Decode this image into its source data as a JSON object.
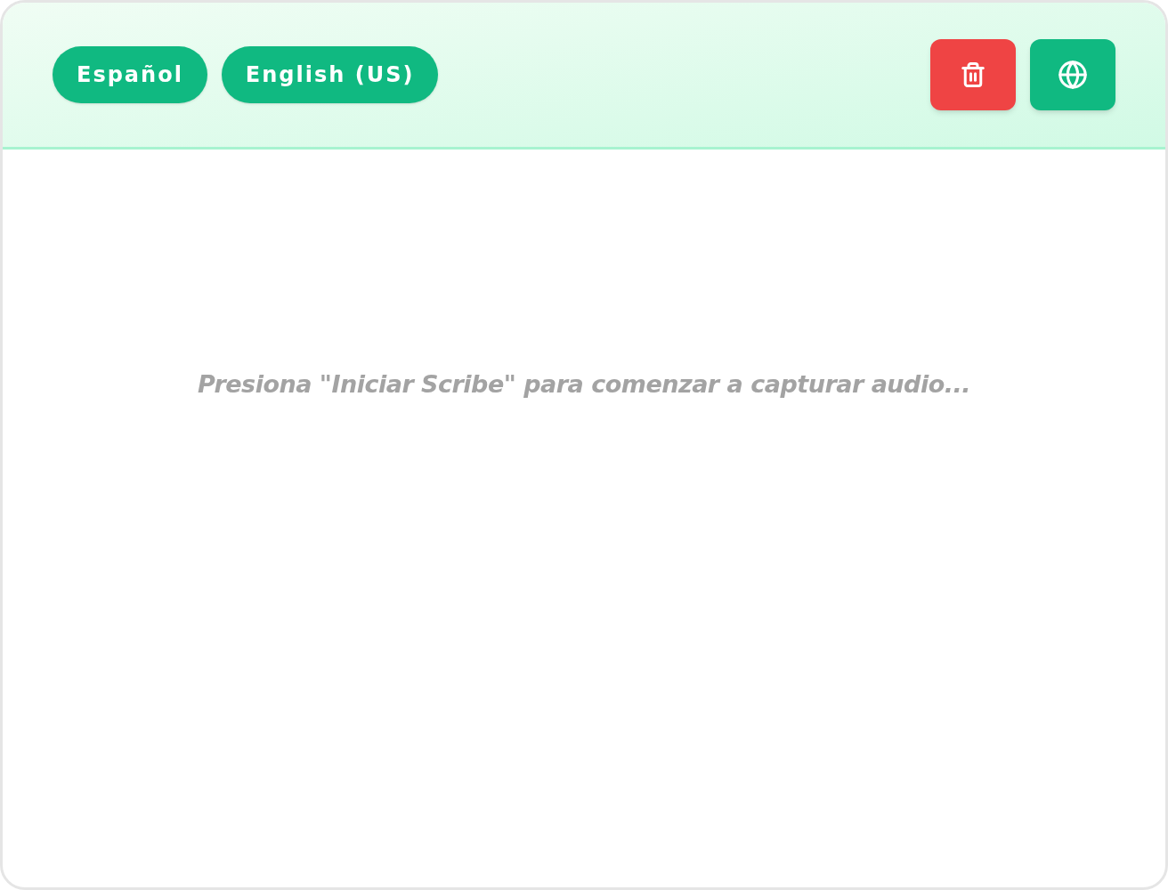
{
  "language_chips": [
    {
      "label": "Español"
    },
    {
      "label": "English (US)"
    }
  ],
  "transcript": {
    "empty_message": "Presiona \"Iniciar Scribe\" para comenzar a capturar audio..."
  }
}
